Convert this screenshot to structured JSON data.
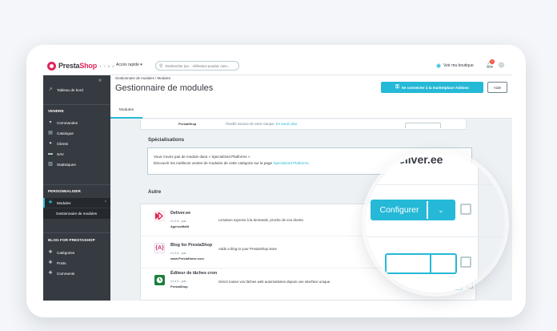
{
  "topbar": {
    "brand_a": "Presta",
    "brand_b": "Shop",
    "version": "1.7.6.X",
    "quick_access": "Accès rapide ▾",
    "search_placeholder": "Rechercher (ex. : référence produit, nom...",
    "view_shop": "Voir ma boutique",
    "notif_count": "1"
  },
  "sidebar": {
    "dashboard": "Tableau de bord",
    "sell_section": "VENDRE",
    "sell_items": [
      "Commandes",
      "Catalogue",
      "Clients",
      "SAV",
      "Statistiques"
    ],
    "custom_section": "PERSONNALISER",
    "modules": "Modules",
    "modules_sub": "Gestionnaire de modules",
    "blog_section": "BLOG FOR PRESTASHOP",
    "blog_items": [
      "Catégories",
      "Posts",
      "Comments"
    ]
  },
  "header": {
    "breadcrumb": "Gestionnaire de modules  /  Modules",
    "title": "Gestionnaire de modules",
    "addons_button": "Se connecter à la marketplace Addons",
    "help_button": "Aide",
    "tab_modules": "Modules"
  },
  "prev": {
    "author": "PrestaShop",
    "desc": "l'éveillé sociaux de votre marque. ",
    "link": "En savoir plus"
  },
  "specialisations": {
    "title": "Spécialisations",
    "line1": "Vous n'avez pas de module dans « Specialized Platforms ».",
    "line2": "Découvrir les meilleurs ventes de modules de cette catégorie sur la page ",
    "line2_link": "Specialized Platforms",
    "line2_end": "."
  },
  "autre": {
    "title": "Autre",
    "modules": [
      {
        "name": "Deliver.ee",
        "version": "v1.2.5 - par",
        "author": "AgenceMaltt",
        "desc": "Livraison express à la demande, proche de vos clients."
      },
      {
        "name": "Blog for PrestaShop",
        "version": "v1.3.4 - par",
        "author": "www.PrestaHome.com",
        "desc": "Adds a blog to your PrestaShop store"
      },
      {
        "name": "Éditeur de tâches cron",
        "version": "v1.4.0 - par",
        "author": "PrestaShop",
        "desc": "Gérez toutes vos tâches web automatisées depuis une interface unique."
      }
    ],
    "configure_label": "Configurer"
  },
  "magnifier": {
    "title": "Deliver.ee",
    "configure_label": "Configurer"
  },
  "colors": {
    "accent": "#25b9d7",
    "sidebar": "#363a41",
    "brand_pink": "#e0255d"
  }
}
